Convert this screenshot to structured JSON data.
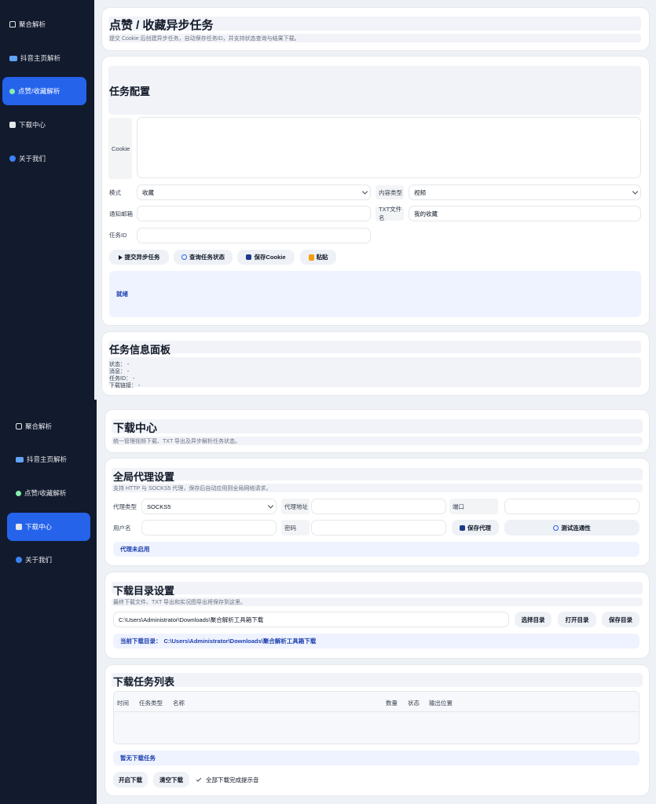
{
  "top_view": {
    "sidebar": {
      "items": [
        {
          "label": "聚合解析",
          "icon": "home-icon"
        },
        {
          "label": "抖音主页解析",
          "icon": "folder-icon"
        },
        {
          "label": "点赞/收藏解析",
          "icon": "circle-icon",
          "active": true
        },
        {
          "label": "下载中心",
          "icon": "save-icon"
        },
        {
          "label": "关于我们",
          "icon": "info-icon"
        }
      ]
    },
    "header": {
      "title": "点赞 / 收藏异步任务",
      "subtitle": "提交 Cookie 后创建异步任务，自动保存任务ID，并支持状态查询与结果下载。"
    },
    "config": {
      "title": "任务配置",
      "cookie_label": "Cookie",
      "cookie_value": "",
      "mode_label": "模式",
      "mode_value": "收藏",
      "content_type_label": "内容类型",
      "content_type_value": "视频",
      "email_label": "通知邮箱",
      "email_value": "",
      "txt_name_label": "TXT文件名",
      "txt_name_value": "我的收藏",
      "task_id_label": "任务ID",
      "task_id_value": "",
      "buttons": {
        "submit": "提交异步任务",
        "query": "查询任务状态",
        "save_cookie": "保存Cookie",
        "paste": "粘贴"
      },
      "status": "就绪"
    },
    "info_panel": {
      "title": "任务信息面板",
      "lines": [
        "状态： -",
        "消息： -",
        "任务ID： -",
        "下载链接： -"
      ]
    }
  },
  "bottom_view": {
    "sidebar": {
      "items": [
        {
          "label": "聚合解析",
          "icon": "home-icon"
        },
        {
          "label": "抖音主页解析",
          "icon": "folder-icon"
        },
        {
          "label": "点赞/收藏解析",
          "icon": "circle-icon"
        },
        {
          "label": "下载中心",
          "icon": "save-icon",
          "active": true
        },
        {
          "label": "关于我们",
          "icon": "info-icon"
        }
      ]
    },
    "header": {
      "title": "下载中心",
      "subtitle": "统一管理视频下载、TXT 导出及异步解析任务状态。"
    },
    "proxy": {
      "title": "全局代理设置",
      "subtitle": "支持 HTTP 与 SOCKS5 代理，保存后自动应用到全局网络请求。",
      "type_label": "代理类型",
      "type_value": "SOCKS5",
      "address_label": "代理地址",
      "address_value": "",
      "port_label": "端口",
      "port_value": "",
      "username_label": "用户名",
      "username_value": "",
      "password_label": "密码",
      "password_value": "",
      "save_button": "保存代理",
      "test_button": "测试连通性",
      "status": "代理未启用"
    },
    "directory": {
      "title": "下载目录设置",
      "subtitle": "最终下载文件、TXT 导出和实况图导出将保存到这里。",
      "path_value": "C:\\Users\\Administrator\\Downloads\\聚合解析工具箱下载",
      "choose_button": "选择目录",
      "open_button": "打开目录",
      "save_button": "保存目录",
      "current_label": "当前下载目录：",
      "current_path": "C:\\Users\\Administrator\\Downloads\\聚合解析工具箱下载"
    },
    "tasks": {
      "title": "下载任务列表",
      "columns": [
        "时间",
        "任务类型",
        "名称",
        "数量",
        "状态",
        "输出位置"
      ],
      "rows": [],
      "empty_text": "暂无下载任务",
      "start_button": "开启下载",
      "clear_button": "清空下载",
      "sound_label": "全部下载完成提示音"
    }
  },
  "colors": {
    "sidebar_bg": "#121a2d",
    "accent": "#2563eb",
    "status_text": "#1e40af"
  }
}
